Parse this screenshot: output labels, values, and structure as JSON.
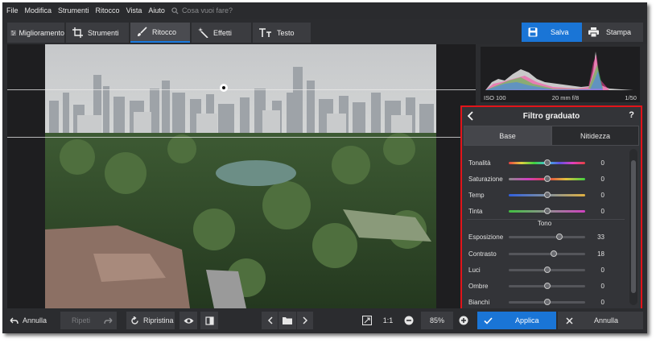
{
  "menu": [
    "File",
    "Modifica",
    "Strumenti",
    "Ritocco",
    "Vista",
    "Aiuto"
  ],
  "search_placeholder": "Cosa vuoi fare?",
  "tabs": [
    {
      "label": "Miglioramento",
      "icon": "sliders-icon"
    },
    {
      "label": "Strumenti",
      "icon": "crop-icon"
    },
    {
      "label": "Ritocco",
      "icon": "brush-icon"
    },
    {
      "label": "Effetti",
      "icon": "magic-wand-icon"
    },
    {
      "label": "Testo",
      "icon": "text-icon"
    }
  ],
  "active_tab": "Ritocco",
  "save_label": "Salva",
  "print_label": "Stampa",
  "histogram": {
    "iso": "ISO 100",
    "lens": "20 mm f/8",
    "shutter": "1/50"
  },
  "panel": {
    "title": "Filtro graduato",
    "help": "?",
    "tabs": [
      "Base",
      "Nitidezza"
    ],
    "active_tab": "Base",
    "color_sliders": [
      {
        "label": "Tonalità",
        "value": "0",
        "level": 0.5
      },
      {
        "label": "Saturazione",
        "value": "0",
        "level": 0.5
      },
      {
        "label": "Temp",
        "value": "0",
        "level": 0.5
      },
      {
        "label": "Tinta",
        "value": "0",
        "level": 0.5
      }
    ],
    "tone_title": "Tono",
    "tone_sliders": [
      {
        "label": "Esposizione",
        "value": "33",
        "level": 0.66
      },
      {
        "label": "Contrasto",
        "value": "18",
        "level": 0.59
      },
      {
        "label": "Luci",
        "value": "0",
        "level": 0.5
      },
      {
        "label": "Ombre",
        "value": "0",
        "level": 0.5
      },
      {
        "label": "Bianchi",
        "value": "0",
        "level": 0.5
      }
    ]
  },
  "bottom": {
    "undo": "Annulla",
    "redo": "Ripeti",
    "reset": "Ripristina",
    "zoom_ratio": "1:1",
    "zoom": "85%",
    "apply": "Applica",
    "cancel": "Annulla"
  },
  "colors": {
    "accent": "#1a75d6",
    "highlight_border": "#e2141a",
    "background": "#2c2d30"
  }
}
